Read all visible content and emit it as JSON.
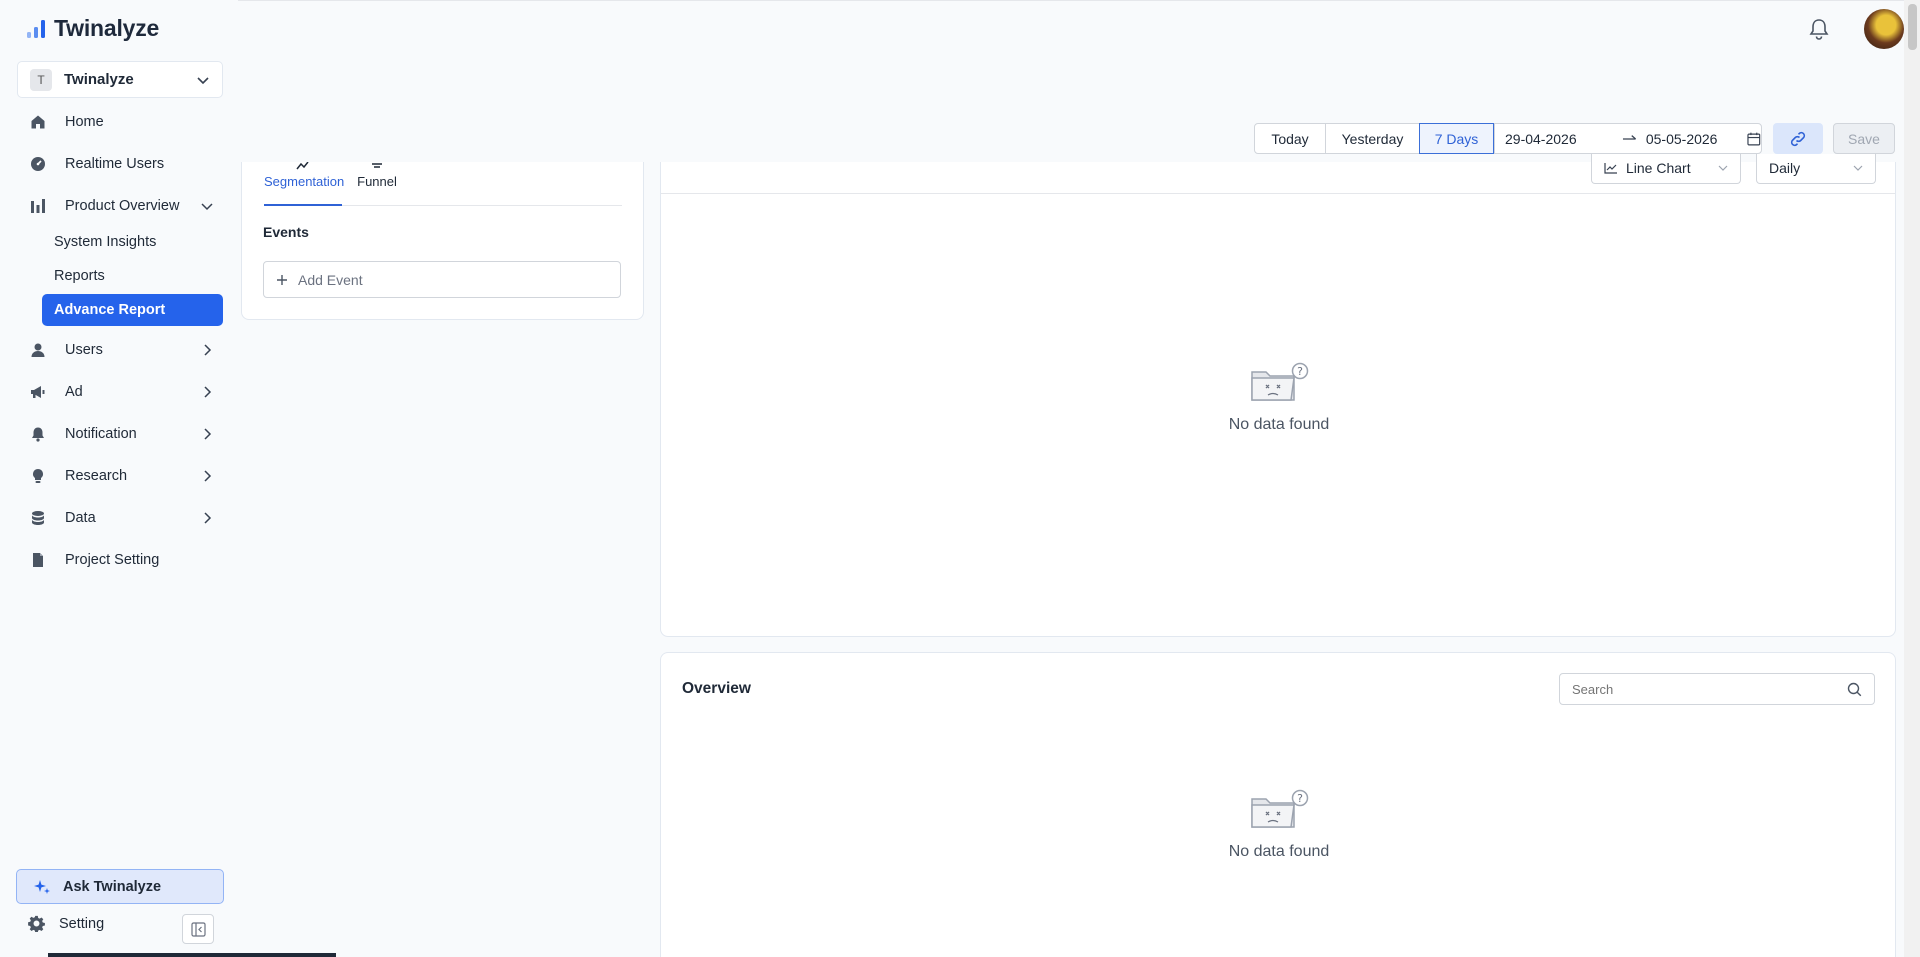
{
  "app": {
    "name": "Twinalyze"
  },
  "workspace": {
    "initial": "T",
    "name": "Twinalyze"
  },
  "nav": {
    "home": "Home",
    "realtime_users": "Realtime Users",
    "product_overview": "Product Overview",
    "sub": {
      "system_insights": "System Insights",
      "reports": "Reports",
      "advance_report": "Advance Report"
    },
    "users": "Users",
    "ad": "Ad",
    "notification": "Notification",
    "research": "Research",
    "data": "Data",
    "project_setting": "Project Setting"
  },
  "ask": {
    "label": "Ask Twinalyze"
  },
  "setting": {
    "label": "Setting"
  },
  "toolbar": {
    "today": "Today",
    "yesterday": "Yesterday",
    "seven_days": "7 Days",
    "start_date": "29-04-2026",
    "end_date": "05-05-2026",
    "save": "Save"
  },
  "query": {
    "tabs": {
      "segmentation": "Segmentation",
      "funnel": "Funnel"
    },
    "events_label": "Events",
    "add_event": "Add Event"
  },
  "chart": {
    "chart_type": "Line Chart",
    "interval": "Daily",
    "empty_text": "No data found"
  },
  "overview": {
    "title": "Overview",
    "search_placeholder": "Search",
    "empty_text": "No data found"
  },
  "colors": {
    "accent": "#2563eb",
    "accent_light": "#dbe6fb"
  }
}
